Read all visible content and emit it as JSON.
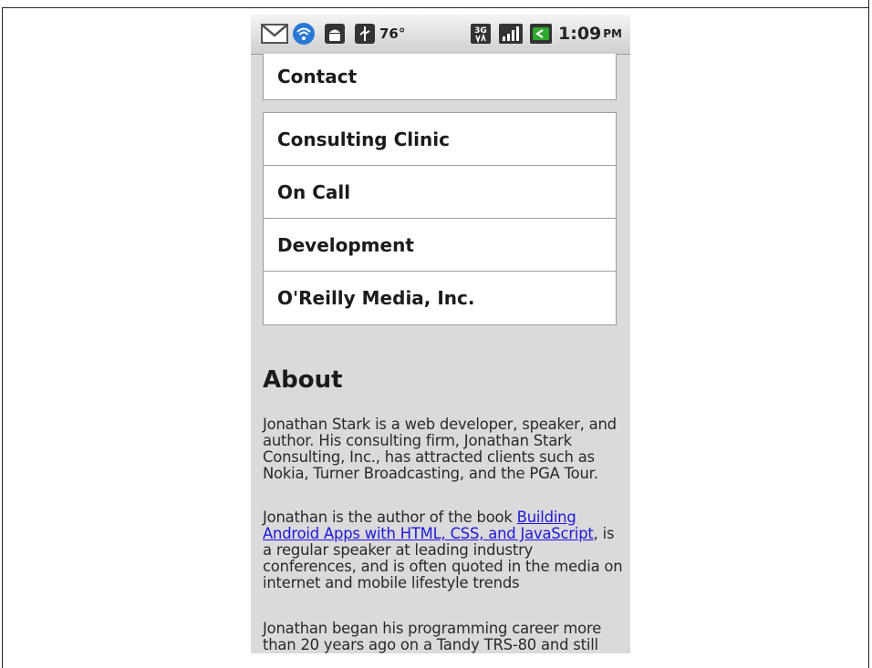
{
  "status_bar": {
    "temperature": "76°",
    "time": "1:09",
    "ampm": "PM",
    "icons": [
      "gmail-icon",
      "wifi-icon",
      "android-debug-icon",
      "usb-icon",
      "3g-icon",
      "signal-icon",
      "battery-icon"
    ]
  },
  "menu": {
    "contact": "Contact",
    "items": [
      "Consulting Clinic",
      "On Call",
      "Development",
      "O'Reilly Media, Inc."
    ]
  },
  "about": {
    "heading": "About",
    "paragraph1": "Jonathan Stark is a web developer, speaker, and author. His consulting firm, Jonathan Stark Consulting, Inc., has attracted clients such as Nokia, Turner Broadcasting, and the PGA Tour.",
    "paragraph2_before": "Jonathan is the author of the book ",
    "paragraph2_link": "Building Android Apps with HTML, CSS, and JavaScript",
    "paragraph2_after": ", is a regular speaker at leading industry conferences, and is often quoted in the media on internet and mobile lifestyle trends",
    "paragraph3": "Jonathan began his programming career more than 20 years ago on a Tandy TRS-80 and still"
  },
  "colors": {
    "page_background": "#dcd9dc",
    "card_background": "#ffffff",
    "link": "#1a1ad8",
    "battery_green": "#2fa82f"
  }
}
